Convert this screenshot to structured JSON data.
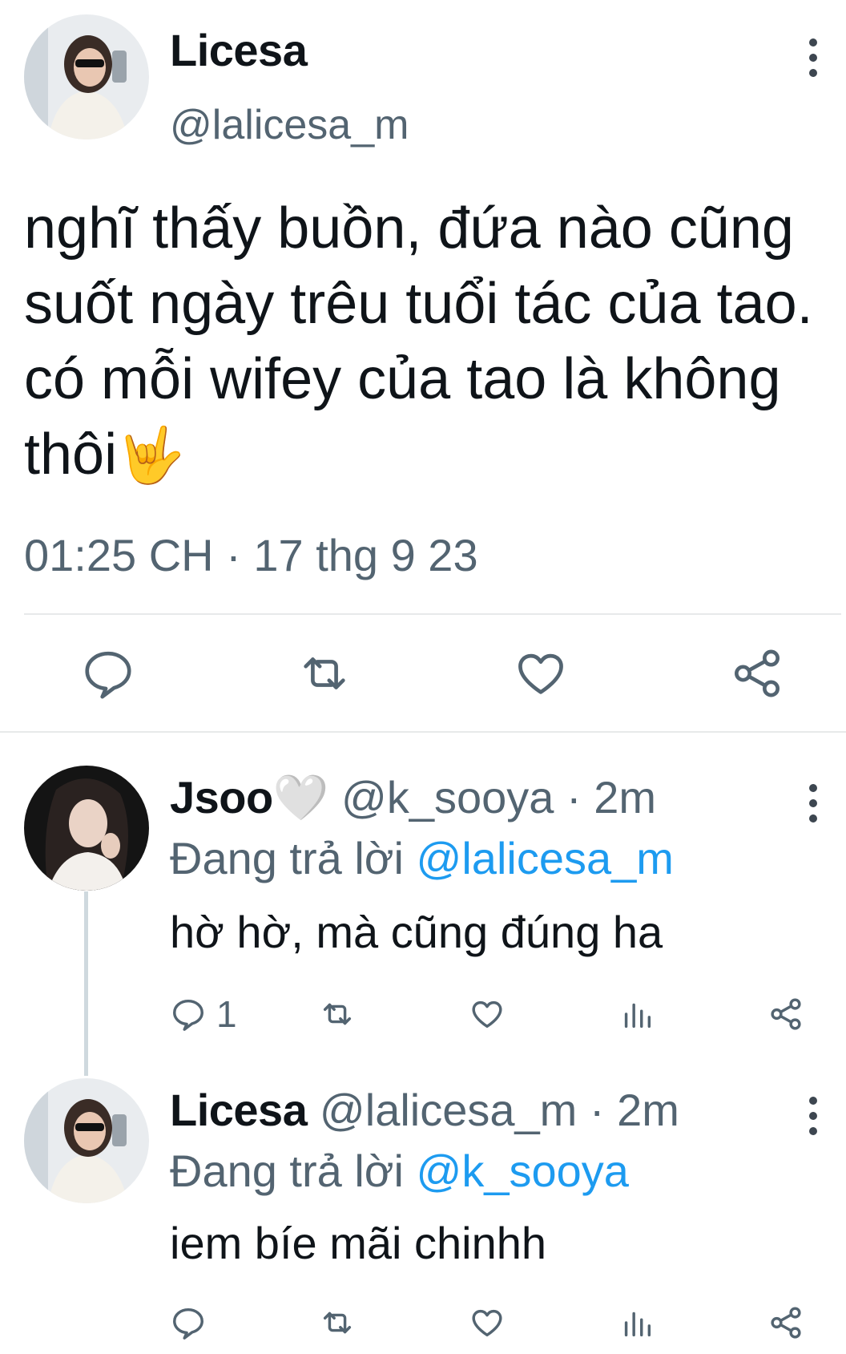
{
  "main_tweet": {
    "display_name": "Licesa",
    "handle": "@lalicesa_m",
    "text": "nghĩ thấy buồn, đứa nào cũng suốt ngày trêu tuổi tác của tao. có mỗi wifey của tao là không thôi",
    "emoji": "🤟",
    "timestamp": "01:25 CH · 17 thg 9 23",
    "actions": [
      "reply-icon",
      "retweet-icon",
      "like-icon",
      "share-icon"
    ]
  },
  "replies": [
    {
      "display_name": "Jsoo",
      "name_emoji": "🤍",
      "handle_time": "@k_sooya · 2m",
      "replying_prefix": "Đang trả lời",
      "replying_to": "@lalicesa_m",
      "text": "hờ hờ, mà cũng đúng ha",
      "reply_count": "1"
    },
    {
      "display_name": "Licesa",
      "handle_time": "@lalicesa_m · 2m",
      "replying_prefix": "Đang trả lời",
      "replying_to": "@k_sooya",
      "text": "iem bíe mãi chinhh",
      "reply_count": ""
    }
  ],
  "colors": {
    "text_primary": "#0f1419",
    "text_secondary": "#536471",
    "mention": "#1d9bf0",
    "divider": "#e7e9ea",
    "icon": "#536471"
  }
}
